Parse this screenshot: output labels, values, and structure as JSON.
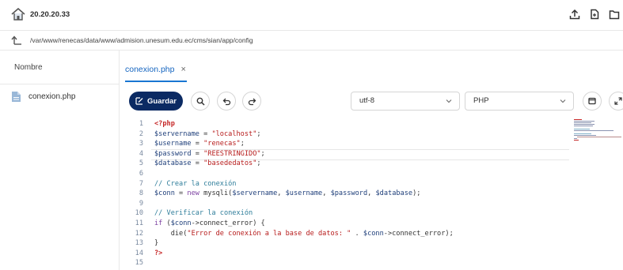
{
  "header": {
    "host": "20.20.20.33",
    "host_icon": "home-icon",
    "actions": [
      "upload-icon",
      "new-file-icon",
      "new-folder-icon"
    ]
  },
  "pathbar": {
    "path": "/var/www/renecas/data/www/admision.unesum.edu.ec/cms/sian/app/config",
    "icon": "level-up-icon"
  },
  "sidebar": {
    "header": "Nombre",
    "files": [
      {
        "name": "conexion.php",
        "icon": "file-icon"
      }
    ]
  },
  "tabs": [
    {
      "label": "conexion.php",
      "close": "×"
    }
  ],
  "toolbar": {
    "save_label": "Guardar",
    "encoding": "utf-8",
    "language": "PHP"
  },
  "editor": {
    "lines": [
      {
        "n": "1",
        "text": "<?php"
      },
      {
        "n": "2",
        "text": "$servername = \"localhost\";"
      },
      {
        "n": "3",
        "text": "$username = \"renecas\";"
      },
      {
        "n": "4",
        "text": "$password = \"REESTRINGIDO\";"
      },
      {
        "n": "5",
        "text": "$database = \"basededatos\";"
      },
      {
        "n": "6",
        "text": ""
      },
      {
        "n": "7",
        "text": "// Crear la conexión"
      },
      {
        "n": "8",
        "text": "$conn = new mysqli($servername, $username, $password, $database);"
      },
      {
        "n": "9",
        "text": ""
      },
      {
        "n": "10",
        "text": "// Verificar la conexión"
      },
      {
        "n": "11",
        "text": "if ($conn->connect_error) {"
      },
      {
        "n": "12",
        "text": "    die(\"Error de conexión a la base de datos: \" . $conn->connect_error);"
      },
      {
        "n": "13",
        "text": "}"
      },
      {
        "n": "14",
        "text": "?>"
      },
      {
        "n": "15",
        "text": ""
      }
    ],
    "active_line": "4"
  },
  "colors": {
    "accent": "#1976d2",
    "save_bg": "#0b2a63",
    "keyword": "#c62828",
    "string": "#b71c1c",
    "comment": "#2e7d9a",
    "line_number": "#7a8aa0"
  }
}
